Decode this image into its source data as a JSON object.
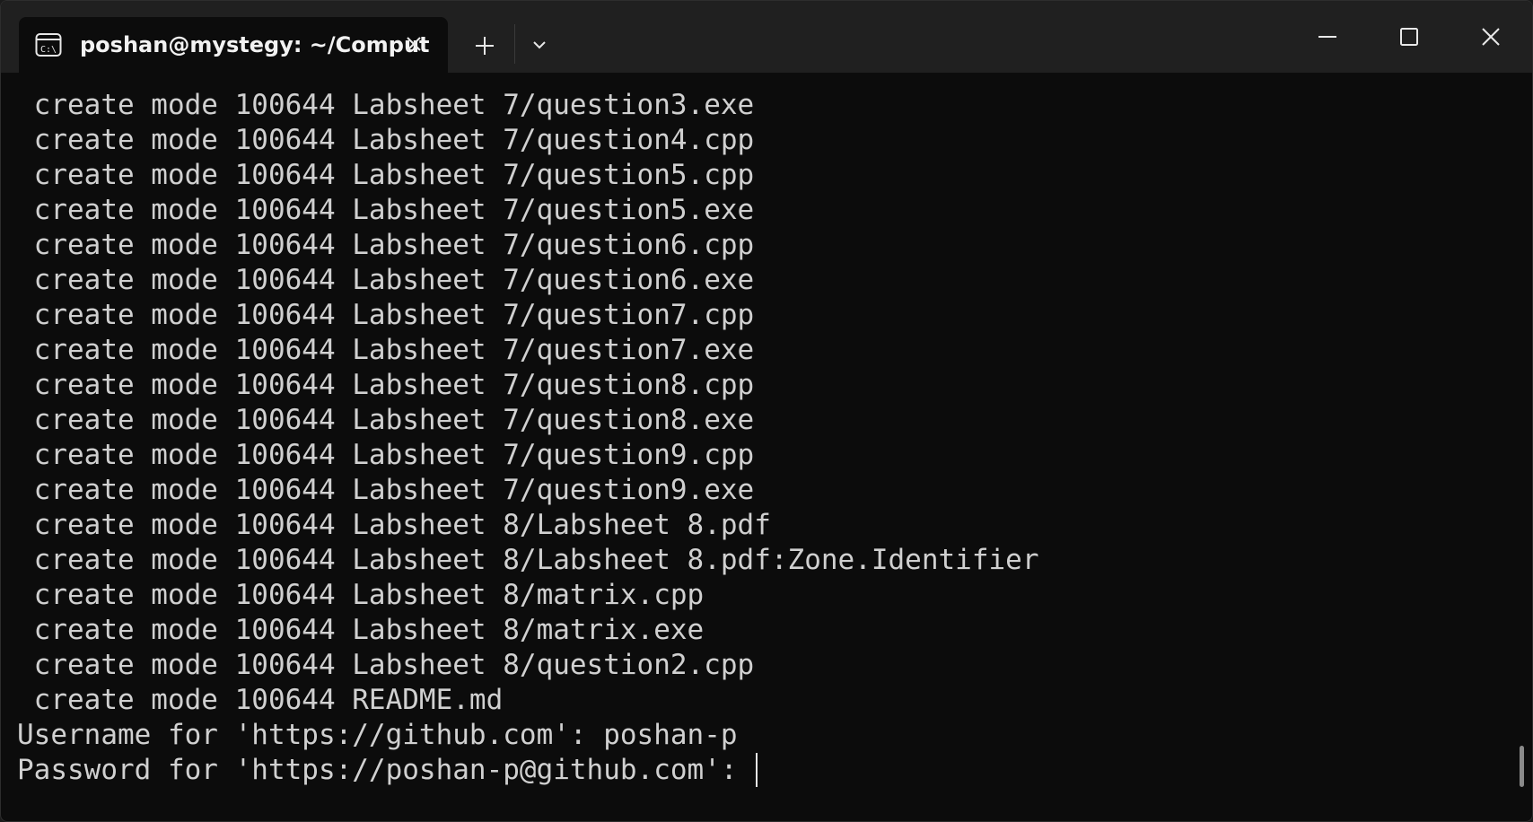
{
  "window": {
    "tab_title": "poshan@mystegy: ~/Comput",
    "icons": {
      "tab_icon": "terminal-icon",
      "tab_close": "close-icon",
      "new_tab": "plus-icon",
      "dropdown": "chevron-down-icon",
      "minimize": "minimize-icon",
      "maximize": "maximize-icon",
      "close": "close-icon"
    }
  },
  "terminal": {
    "lines": [
      " create mode 100644 Labsheet 7/question3.exe",
      " create mode 100644 Labsheet 7/question4.cpp",
      " create mode 100644 Labsheet 7/question5.cpp",
      " create mode 100644 Labsheet 7/question5.exe",
      " create mode 100644 Labsheet 7/question6.cpp",
      " create mode 100644 Labsheet 7/question6.exe",
      " create mode 100644 Labsheet 7/question7.cpp",
      " create mode 100644 Labsheet 7/question7.exe",
      " create mode 100644 Labsheet 7/question8.cpp",
      " create mode 100644 Labsheet 7/question8.exe",
      " create mode 100644 Labsheet 7/question9.cpp",
      " create mode 100644 Labsheet 7/question9.exe",
      " create mode 100644 Labsheet 8/Labsheet 8.pdf",
      " create mode 100644 Labsheet 8/Labsheet 8.pdf:Zone.Identifier",
      " create mode 100644 Labsheet 8/matrix.cpp",
      " create mode 100644 Labsheet 8/matrix.exe",
      " create mode 100644 Labsheet 8/question2.cpp",
      " create mode 100644 README.md",
      "Username for 'https://github.com': poshan-p",
      "Password for 'https://poshan-p@github.com': "
    ]
  },
  "colors": {
    "background": "#0c0c0c",
    "titlebar": "#202020",
    "text": "#d0d0d0"
  }
}
